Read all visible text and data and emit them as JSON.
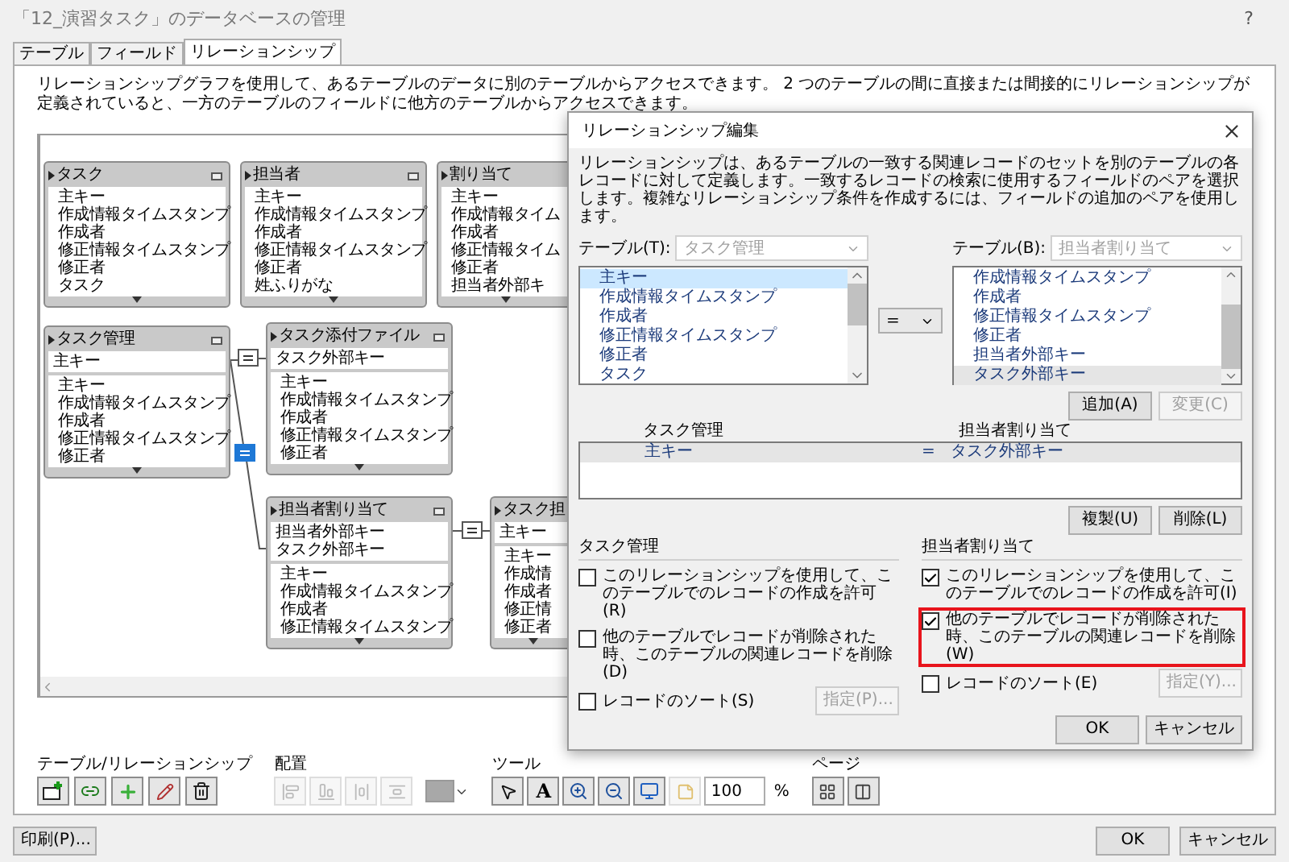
{
  "window": {
    "title": "「12_演習タスク」のデータベースの管理",
    "help": "?"
  },
  "tabs": [
    {
      "label": "テーブル",
      "selected": false
    },
    {
      "label": "フィールド",
      "selected": false
    },
    {
      "label": "リレーションシップ",
      "selected": true
    }
  ],
  "description": "リレーションシップグラフを使用して、あるテーブルのデータに別のテーブルからアクセスできます。 2 つのテーブルの間に直接または間接的にリレーションシップが定義されていると、一方のテーブルのフィールドに他方のテーブルからアクセスできます。",
  "graph": {
    "tables": [
      {
        "name": "タスク",
        "fields": [
          "主キー",
          "作成情報タイムスタンプ",
          "作成者",
          "修正情報タイムスタンプ",
          "修正者",
          "タスク"
        ]
      },
      {
        "name": "担当者",
        "fields": [
          "主キー",
          "作成情報タイムスタンプ",
          "作成者",
          "修正情報タイムスタンプ",
          "修正者",
          "姓ふりがな"
        ]
      },
      {
        "name": "割り当て",
        "fields": [
          "主キー",
          "作成情報タイム",
          "作成者",
          "修正情報タイム",
          "修正者",
          "担当者外部キ"
        ]
      },
      {
        "name": "タスク管理",
        "keys": [
          "主キー"
        ],
        "fields": [
          "主キー",
          "作成情報タイムスタンプ",
          "作成者",
          "修正情報タイムスタンプ",
          "修正者"
        ]
      },
      {
        "name": "タスク添付ファイル",
        "keys": [
          "タスク外部キー"
        ],
        "fields": [
          "主キー",
          "作成情報タイムスタンプ",
          "作成者",
          "修正情報タイムスタンプ",
          "修正者"
        ]
      },
      {
        "name": "担当者割り当て",
        "keys": [
          "担当者外部キー",
          "タスク外部キー"
        ],
        "fields": [
          "主キー",
          "作成情報タイムスタンプ",
          "作成者",
          "修正情報タイムスタンプ"
        ]
      },
      {
        "name": "タスク担",
        "keys": [
          "主キー"
        ],
        "fields": [
          "主キー",
          "作成情",
          "作成者",
          "修正情",
          "修正者"
        ]
      }
    ],
    "relationships": [
      {
        "selected": false
      },
      {
        "selected": true
      },
      {
        "selected": false
      }
    ]
  },
  "toolbar": {
    "groups": [
      {
        "label": "テーブル/リレーションシップ"
      },
      {
        "label": "配置"
      },
      {
        "label": "ツール",
        "text_tool": "A",
        "zoom": "100",
        "unit": "%"
      },
      {
        "label": "ページ"
      }
    ]
  },
  "print_button": "印刷(P)...",
  "ok_button": "OK",
  "cancel_button": "キャンセル",
  "dialog": {
    "title": "リレーションシップ編集",
    "description": "リレーションシップは、あるテーブルの一致する関連レコードのセットを別のテーブルの各レコードに対して定義します。一致するレコードの検索に使用するフィールドのペアを選択します。複雑なリレーションシップ条件を作成するには、フィールドの追加のペアを使用します。",
    "left": {
      "label": "テーブル(T):",
      "table": "タスク管理",
      "fields": [
        {
          "label": "主キー",
          "selected": true
        },
        {
          "label": "作成情報タイムスタンプ",
          "selected": false
        },
        {
          "label": "作成者",
          "selected": false
        },
        {
          "label": "修正情報タイムスタンプ",
          "selected": false
        },
        {
          "label": "修正者",
          "selected": false
        },
        {
          "label": "タスク",
          "selected": false
        }
      ]
    },
    "operator": "=",
    "right": {
      "label": "テーブル(B):",
      "table": "担当者割り当て",
      "fields": [
        {
          "label": "作成情報タイムスタンプ",
          "selected": false
        },
        {
          "label": "作成者",
          "selected": false
        },
        {
          "label": "修正情報タイムスタンプ",
          "selected": false
        },
        {
          "label": "修正者",
          "selected": false
        },
        {
          "label": "担当者外部キー",
          "selected": false
        },
        {
          "label": "タスク外部キー",
          "selected": true
        }
      ]
    },
    "add_button": {
      "label": "追加(A)",
      "disabled": false
    },
    "change_button": {
      "label": "変更(C)",
      "disabled": true
    },
    "pairs": {
      "columns": [
        "タスク管理",
        "担当者割り当て"
      ],
      "rows": [
        {
          "left": "主キー",
          "operator": "=",
          "right": "タスク外部キー",
          "selected": true
        }
      ]
    },
    "duplicate_button": "複製(U)",
    "delete_button": "削除(L)",
    "options": [
      {
        "table": "タスク管理",
        "checkboxes": [
          {
            "label": "このリレーションシップを使用して、このテーブルでのレコードの作成を許可(R)",
            "checked": false,
            "highlighted": false
          },
          {
            "label": "他のテーブルでレコードが削除された時、このテーブルの関連レコードを削除(D)",
            "checked": false,
            "highlighted": false
          }
        ],
        "sort": {
          "label": "レコードのソート(S)",
          "checked": false
        },
        "sort_button": {
          "label": "指定(P)...",
          "disabled": true
        }
      },
      {
        "table": "担当者割り当て",
        "checkboxes": [
          {
            "label": "このリレーションシップを使用して、このテーブルでのレコードの作成を許可(I)",
            "checked": true,
            "highlighted": false
          },
          {
            "label": "他のテーブルでレコードが削除された時、このテーブルの関連レコードを削除(W)",
            "checked": true,
            "highlighted": true
          }
        ],
        "sort": {
          "label": "レコードのソート(E)",
          "checked": false
        },
        "sort_button": {
          "label": "指定(Y)...",
          "disabled": true
        }
      }
    ],
    "ok_button": "OK",
    "cancel_button": "キャンセル"
  }
}
